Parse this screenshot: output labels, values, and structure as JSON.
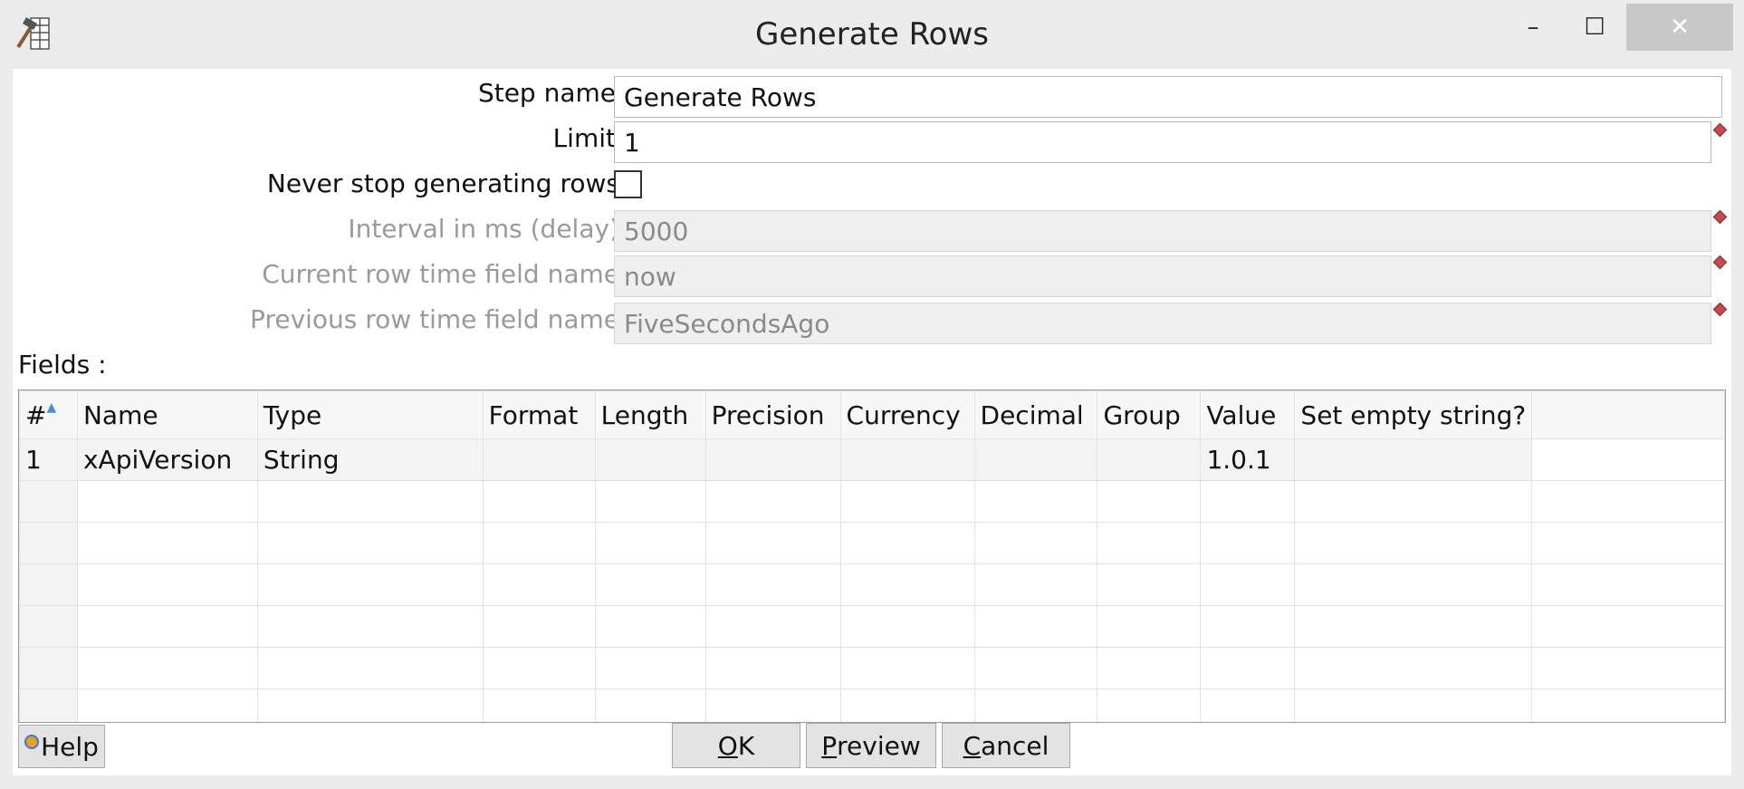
{
  "window": {
    "title": "Generate Rows",
    "minimize": "–",
    "maximize": "☐",
    "close": "✕"
  },
  "form": {
    "step_name": {
      "label": "Step name",
      "value": "Generate Rows"
    },
    "limit": {
      "label": "Limit",
      "value": "1"
    },
    "never_stop": {
      "label": "Never stop generating rows",
      "checked": false
    },
    "interval": {
      "label": "Interval in ms (delay)",
      "value": "5000"
    },
    "current_row_time": {
      "label": "Current row time field name",
      "value": "now"
    },
    "previous_row_time": {
      "label": "Previous row time field name",
      "value": "FiveSecondsAgo"
    }
  },
  "fields": {
    "label": "Fields :",
    "columns": [
      "#",
      "Name",
      "Type",
      "Format",
      "Length",
      "Precision",
      "Currency",
      "Decimal",
      "Group",
      "Value",
      "Set empty string?"
    ],
    "rows": [
      [
        "1",
        "xApiVersion",
        "String",
        "",
        "",
        "",
        "",
        "",
        "",
        "1.0.1",
        ""
      ]
    ]
  },
  "buttons": {
    "help": "Help",
    "ok_prefix": "O",
    "ok_rest": "K",
    "preview_prefix": "P",
    "preview_rest": "review",
    "cancel_prefix": "C",
    "cancel_rest": "ancel"
  },
  "colors": {
    "accent_sort": "#4a90d9",
    "variable_marker": "#c84a4a"
  }
}
